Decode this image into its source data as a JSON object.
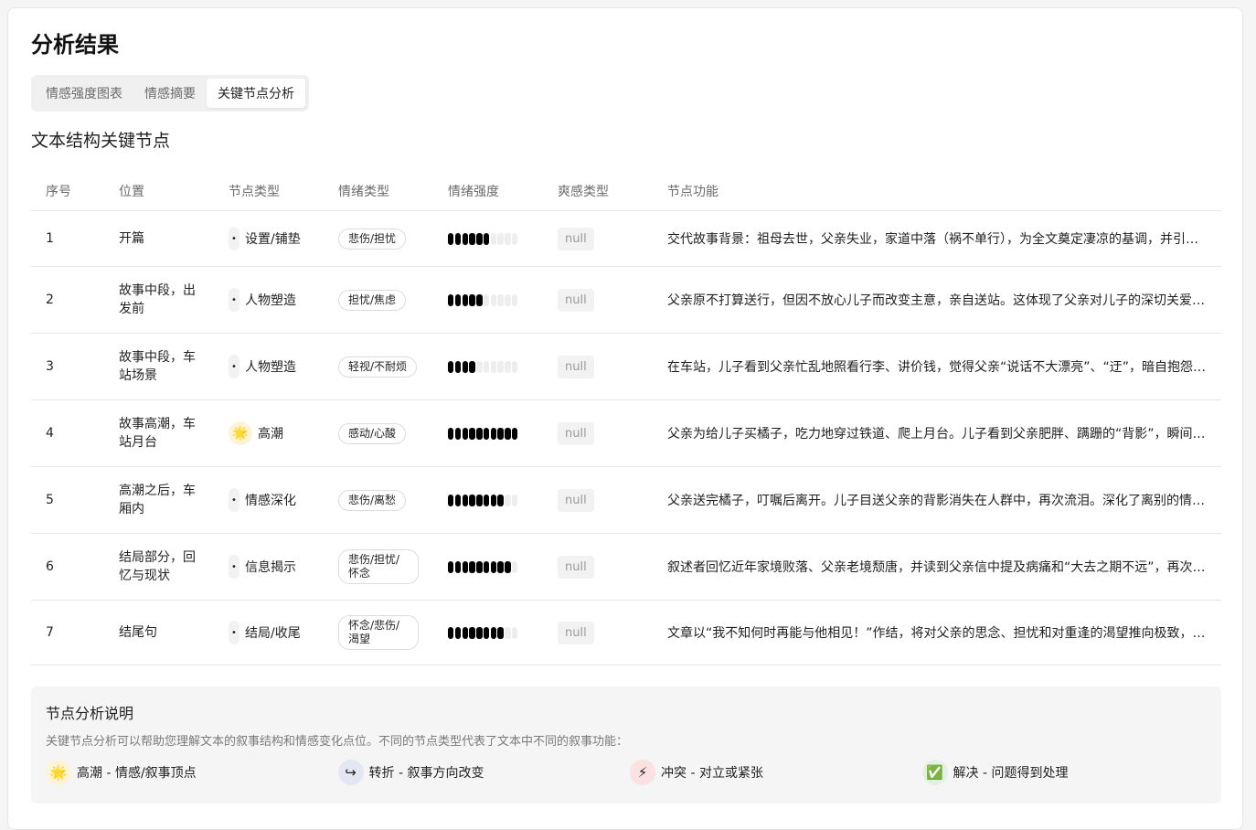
{
  "header": {
    "title": "分析结果"
  },
  "tabs": [
    {
      "label": "情感强度图表",
      "active": false
    },
    {
      "label": "情感摘要",
      "active": false
    },
    {
      "label": "关键节点分析",
      "active": true
    }
  ],
  "section": {
    "title": "文本结构关键节点"
  },
  "table": {
    "columns": [
      "序号",
      "位置",
      "节点类型",
      "情绪类型",
      "情绪强度",
      "爽感类型",
      "节点功能"
    ],
    "rows": [
      {
        "index": "1",
        "position": "开篇",
        "node_type": "设置/铺垫",
        "node_icon": "dot-icon",
        "emotion": "悲伤/担忧",
        "intensity": 6,
        "thrill": "null",
        "function": "交代故事背景：祖母去世，父亲失业，家道中落（祸不单行），为全文奠定凄凉的基调，并引出父子离别的场景。"
      },
      {
        "index": "2",
        "position": "故事中段，出发前",
        "node_type": "人物塑造",
        "node_icon": "dot-icon",
        "emotion": "担忧/焦虑",
        "intensity": 5,
        "thrill": "null",
        "function": "父亲原不打算送行，但因不放心儿子而改变主意，亲自送站。这体现了父亲对儿子的深切关爱与牵挂。"
      },
      {
        "index": "3",
        "position": "故事中段，车站场景",
        "node_type": "人物塑造",
        "node_icon": "dot-icon",
        "emotion": "轻视/不耐烦",
        "intensity": 4,
        "thrill": "null",
        "function": "在车站，儿子看到父亲忙乱地照看行李、讲价钱，觉得父亲“说话不大漂亮”、“迂”，暗自抱怨其多事。"
      },
      {
        "index": "4",
        "position": "故事高潮，车站月台",
        "node_type": "高潮",
        "node_icon": "sun-icon",
        "emotion": "感动/心酸",
        "intensity": 10,
        "thrill": "null",
        "function": "父亲为给儿子买橘子，吃力地穿过铁道、爬上月台。儿子看到父亲肥胖、蹒跚的“背影”，瞬间泪流满面。"
      },
      {
        "index": "5",
        "position": "高潮之后，车厢内",
        "node_type": "情感深化",
        "node_icon": "dot-icon",
        "emotion": "悲伤/离愁",
        "intensity": 8,
        "thrill": "null",
        "function": "父亲送完橘子，叮嘱后离开。儿子目送父亲的背影消失在人群中，再次流泪。深化了离别的情感与不舍。"
      },
      {
        "index": "6",
        "position": "结局部分，回忆与现状",
        "node_type": "信息揭示",
        "node_icon": "dot-icon",
        "emotion": "悲伤/担忧/怀念",
        "intensity": 9,
        "thrill": "null",
        "function": "叙述者回忆近年家境败落、父亲老境颓唐，并读到父亲信中提及病痛和“大去之期不远”，再次泪下。"
      },
      {
        "index": "7",
        "position": "结尾句",
        "node_type": "结局/收尾",
        "node_icon": "dot-icon",
        "emotion": "怀念/悲伤/渴望",
        "intensity": 8,
        "thrill": "null",
        "function": "文章以“我不知何时再能与他相见！”作结，将对父亲的思念、担忧和对重逢的渴望推向极致，余韵悠长。"
      }
    ],
    "intensity_max": 10
  },
  "legend": {
    "title": "节点分析说明",
    "description": "关键节点分析可以帮助您理解文本的叙事结构和情感变化点位。不同的节点类型代表了文本中不同的叙事功能：",
    "items": [
      {
        "icon": "sun-icon",
        "glyph": "🌟",
        "label": "高潮 - 情感/叙事顶点",
        "bg": "#fdf3d6"
      },
      {
        "icon": "turn-icon",
        "glyph": "↪",
        "label": "转折 - 叙事方向改变",
        "bg": "#e3e7f3"
      },
      {
        "icon": "lightning-icon",
        "glyph": "⚡",
        "label": "冲突 - 对立或紧张",
        "bg": "#fbe1e1"
      },
      {
        "icon": "check-icon",
        "glyph": "✅",
        "label": "解决 - 问题得到处理",
        "bg": "#e2f1e3"
      }
    ]
  },
  "colors": {
    "bar_on": "#000000",
    "bar_off": "#eeeeee",
    "active_tab_bg": "#ffffff"
  }
}
